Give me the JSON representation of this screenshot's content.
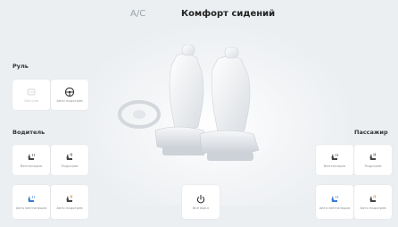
{
  "header": {
    "tab_ac": "A/C",
    "tab_seat_comfort": "Комфорт сидений"
  },
  "steering": {
    "section_label": "Руль",
    "tiles": [
      {
        "label": "Обогрев",
        "icon": "steering-heat-icon",
        "state": "disabled"
      },
      {
        "label": "Авто подогрев",
        "icon": "steering-wheel-icon",
        "state": "enabled"
      }
    ]
  },
  "driver": {
    "section_label": "Водитель",
    "tiles": [
      {
        "label": "Вентиляция",
        "icon": "seat-ventilation-icon"
      },
      {
        "label": "Подогрев",
        "icon": "seat-heat-icon"
      },
      {
        "label": "Авто вентиляция",
        "icon": "seat-auto-ventilation-icon"
      },
      {
        "label": "Авто подогрев",
        "icon": "seat-auto-heat-icon"
      }
    ]
  },
  "passenger": {
    "section_label": "Пассажир",
    "tiles": [
      {
        "label": "Вентиляция",
        "icon": "seat-ventilation-icon"
      },
      {
        "label": "Подогрев",
        "icon": "seat-heat-icon"
      },
      {
        "label": "Авто вентиляция",
        "icon": "seat-auto-ventilation-icon"
      },
      {
        "label": "Авто подогрев",
        "icon": "seat-auto-heat-icon"
      }
    ]
  },
  "center": {
    "power_label": "Всё выкл",
    "power_icon": "power-icon"
  },
  "colors": {
    "background": "#eceff2",
    "tile": "#ffffff",
    "text_primary": "#222222",
    "text_muted": "#9aa0a6"
  }
}
